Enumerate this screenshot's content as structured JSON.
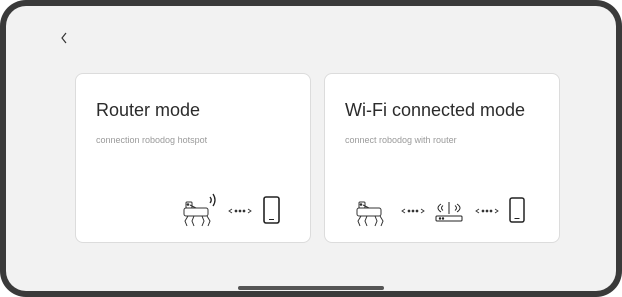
{
  "header": {
    "back_icon": "chevron-left-icon"
  },
  "cards": [
    {
      "title": "Router mode",
      "subtitle": "connection robodog hotspot",
      "icons": [
        "robodog-icon",
        "signal-waves-icon",
        "dotted-arrow-icon",
        "phone-icon"
      ]
    },
    {
      "title": "Wi-Fi connected mode",
      "subtitle": "connect robodog with router",
      "icons": [
        "robodog-icon",
        "dotted-arrow-icon",
        "router-icon",
        "dotted-arrow-icon",
        "phone-icon"
      ]
    }
  ],
  "colors": {
    "background": "#f2f2f2",
    "card": "#ffffff",
    "title": "#2b2b2b",
    "subtitle": "#9a9a9a",
    "icon": "#333333"
  }
}
